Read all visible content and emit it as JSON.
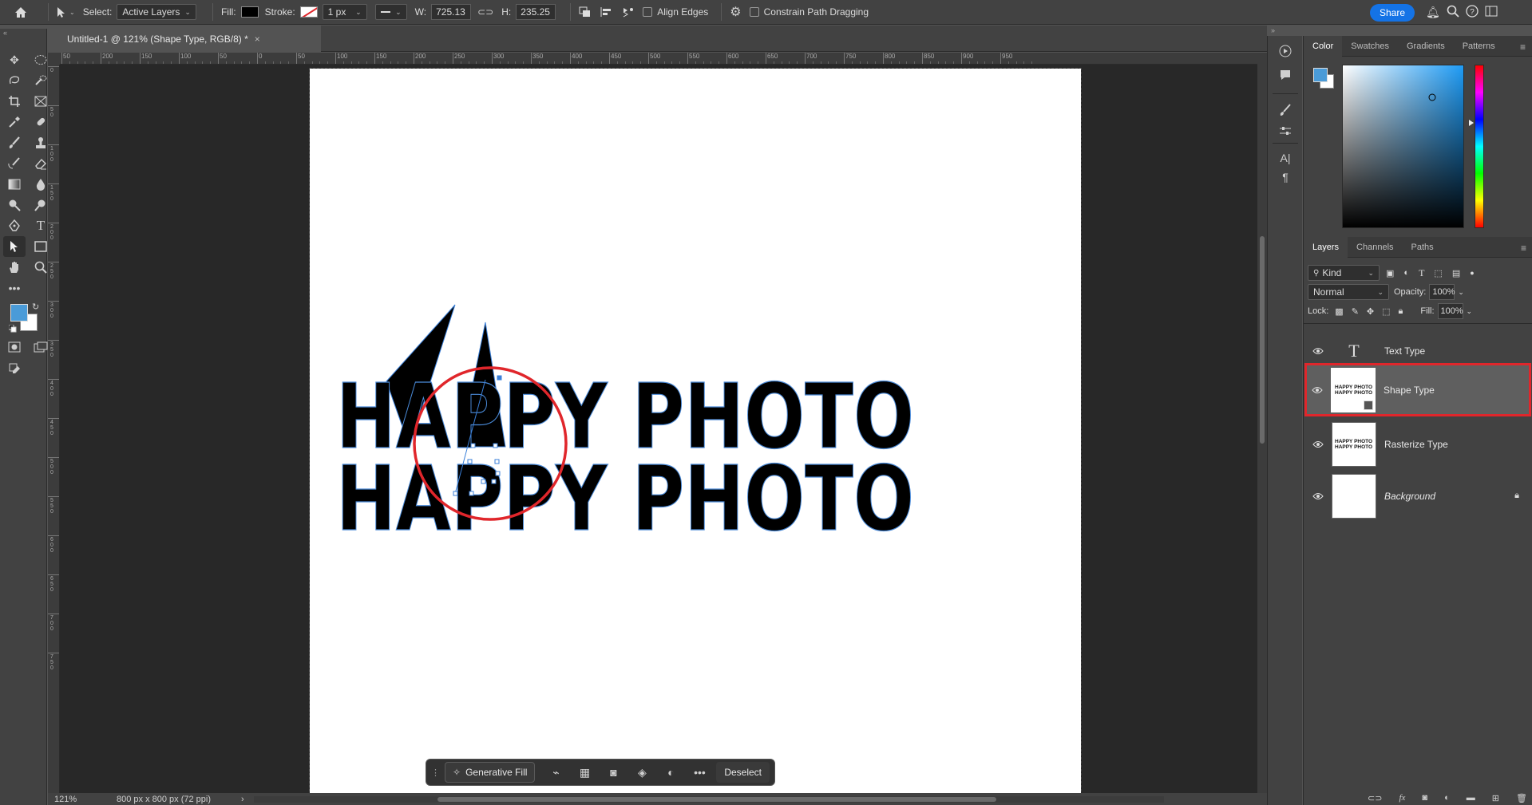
{
  "options_bar": {
    "select_label": "Select:",
    "select_value": "Active Layers",
    "fill_label": "Fill:",
    "stroke_label": "Stroke:",
    "stroke_width": "1 px",
    "w_label": "W:",
    "w_value": "725.13",
    "h_label": "H:",
    "h_value": "235.25",
    "align_edges": "Align Edges",
    "constrain": "Constrain Path Dragging",
    "share": "Share"
  },
  "document": {
    "tab_title": "Untitled-1 @ 121% (Shape Type, RGB/8) *",
    "tab_close": "×",
    "canvas_text_line1": "HAPPY PHOTO",
    "canvas_text_line2": "HAPPY PHOTO",
    "zoom": "121%",
    "doc_info": "800 px x 800 px (72 ppi)",
    "ruler_h_labels": [
      "50",
      "200",
      "150",
      "100",
      "50",
      "0",
      "50",
      "100",
      "150",
      "200",
      "250",
      "300",
      "350",
      "400",
      "450",
      "500",
      "550",
      "600",
      "650",
      "700",
      "750",
      "800",
      "850",
      "900",
      "950"
    ],
    "ruler_v_labels": [
      "0",
      "5\n0",
      "1\n0\n0",
      "1\n5\n0",
      "2\n0\n0",
      "2\n5\n0",
      "3\n0\n0",
      "3\n5\n0",
      "4\n0\n0",
      "4\n5\n0",
      "5\n0\n0",
      "5\n5\n0",
      "6\n0\n0",
      "6\n5\n0",
      "7\n0\n0",
      "7\n5\n0"
    ]
  },
  "context_bar": {
    "generative_fill": "Generative Fill",
    "deselect": "Deselect"
  },
  "color_panel": {
    "tabs": [
      "Color",
      "Swatches",
      "Gradients",
      "Patterns"
    ],
    "foreground": "#4a9bd8",
    "hue_color": "#1e9bf5"
  },
  "layers_panel": {
    "tabs": [
      "Layers",
      "Channels",
      "Paths"
    ],
    "filter_kind": "Kind",
    "blend_mode": "Normal",
    "opacity_label": "Opacity:",
    "opacity_value": "100%",
    "lock_label": "Lock:",
    "fill_label": "Fill:",
    "fill_value": "100%",
    "layers": [
      {
        "name": "Text Type",
        "kind": "text"
      },
      {
        "name": "Shape Type",
        "kind": "shape",
        "selected": true
      },
      {
        "name": "Rasterize Type",
        "kind": "pixel"
      },
      {
        "name": "Background",
        "kind": "background",
        "locked": true
      }
    ],
    "thumb_text": "HAPPY PHOTO"
  },
  "colors": {
    "highlight_red": "#e0262b",
    "accent_blue": "#1473e6"
  }
}
